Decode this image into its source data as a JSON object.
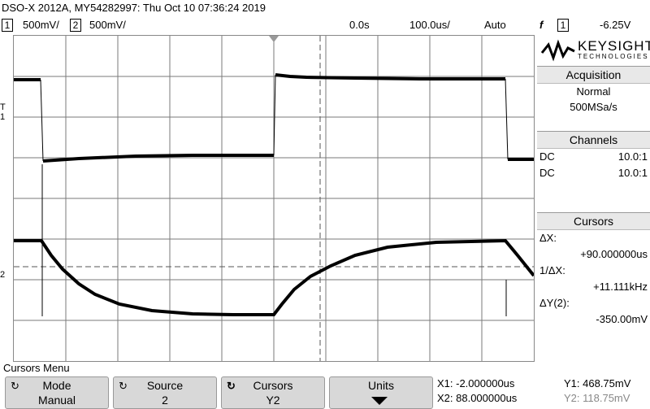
{
  "title": "DSO-X 2012A, MY54282997: Thu Oct 10 07:36:24 2019",
  "status": {
    "ch1_num": "1",
    "ch1_scale": "500mV/",
    "ch2_num": "2",
    "ch2_scale": "500mV/",
    "time_offset": "0.0s",
    "time_scale": "100.0us/",
    "trigger_mode": "Auto",
    "trigger_symbol": "f",
    "trigger_source": "1",
    "trigger_level": "-6.25V"
  },
  "logo": {
    "brand": "KEYSIGHT",
    "sub": "TECHNOLOGIES"
  },
  "acquisition": {
    "header": "Acquisition",
    "mode": "Normal",
    "rate": "500MSa/s"
  },
  "channels": {
    "header": "Channels",
    "rows": [
      {
        "coupling": "DC",
        "probe": "10.0:1"
      },
      {
        "coupling": "DC",
        "probe": "10.0:1"
      }
    ]
  },
  "cursors": {
    "header": "Cursors",
    "dx_label": "ΔX:",
    "dx_value": "+90.000000us",
    "inv_label": "1/ΔX:",
    "inv_value": "+11.111kHz",
    "dy_label": "ΔY(2):",
    "dy_value": "-350.00mV"
  },
  "menu_title": "Cursors Menu",
  "softkeys": [
    {
      "label": "Mode",
      "value": "Manual"
    },
    {
      "label": "Source",
      "value": "2"
    },
    {
      "label": "Cursors",
      "value": "Y2"
    },
    {
      "label": "Units",
      "value": ""
    }
  ],
  "readouts": {
    "x1": "X1: -2.000000us",
    "x2": "X2: 88.000000us",
    "y1": "Y1: 468.75mV",
    "y2": "Y2: 118.75mV"
  },
  "markers": {
    "ch1": "1",
    "ch2": "2",
    "trigger_level": "T"
  },
  "colors": {
    "trace": "#000000",
    "grid": "#7a7a7a",
    "panel_header": "#e8e8e8",
    "softkey": "#d8d8d8"
  }
}
